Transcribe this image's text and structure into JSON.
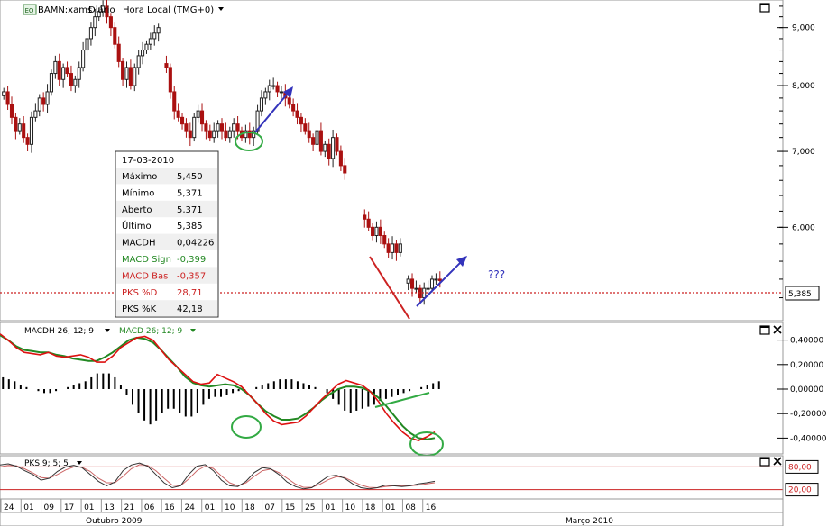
{
  "chart_data": [
    {
      "type": "candlestick",
      "header": {
        "instrument": "BAMN:xams",
        "badge": "EQ",
        "interval": "Diário",
        "timezone": "Hora Local (TMG+0)"
      },
      "ylim": [
        5.0,
        9.45
      ],
      "y_scale": "log",
      "yticks": [
        {
          "v": 9.0,
          "label": "9,000"
        },
        {
          "v": 8.0,
          "label": "8,000"
        },
        {
          "v": 7.0,
          "label": "7,000"
        },
        {
          "v": 6.0,
          "label": "6,000"
        }
      ],
      "last_price": {
        "v": 5.385,
        "label": "5,385",
        "color": "#cc2222"
      },
      "annotation_text": "???",
      "closes": [
        7.9,
        7.7,
        7.5,
        7.3,
        7.4,
        7.2,
        7.1,
        7.5,
        7.6,
        7.8,
        7.7,
        7.9,
        8.2,
        8.4,
        8.1,
        8.3,
        8.2,
        8.0,
        8.1,
        8.3,
        8.6,
        8.8,
        9.0,
        9.2,
        9.3,
        9.4,
        9.2,
        9.0,
        8.7,
        8.4,
        8.1,
        8.3,
        8.0,
        8.3,
        8.5,
        8.6,
        8.7,
        8.8,
        8.9,
        9.0,
        null,
        8.3,
        7.9,
        7.6,
        7.5,
        7.4,
        7.3,
        7.2,
        7.5,
        7.6,
        7.4,
        7.3,
        7.2,
        7.3,
        7.4,
        7.3,
        7.2,
        7.3,
        7.4,
        7.3,
        7.2,
        7.3,
        7.2,
        7.3,
        7.6,
        7.8,
        7.9,
        8.0,
        8.0,
        7.9,
        7.9,
        7.8,
        7.7,
        7.6,
        7.5,
        7.4,
        7.3,
        7.2,
        7.1,
        7.3,
        7.0,
        7.1,
        6.9,
        7.2,
        7.0,
        6.8,
        6.7,
        null,
        null,
        null,
        null,
        6.1,
        6.0,
        5.9,
        6.0,
        5.9,
        5.8,
        5.7,
        5.8,
        5.7,
        5.8,
        null,
        5.4,
        5.3,
        5.3,
        5.2,
        5.3,
        5.3,
        5.4,
        5.4,
        5.385
      ]
    },
    {
      "type": "line",
      "title": "MACDH 26; 12; 9",
      "series_title": "MACD 26; 12; 9",
      "ylim": [
        -0.5,
        0.5
      ],
      "yticks": [
        {
          "v": 0.4,
          "label": "0,40000"
        },
        {
          "v": 0.2,
          "label": "0,20000"
        },
        {
          "v": 0.0,
          "label": "0,00000"
        },
        {
          "v": -0.2,
          "label": "-0,20000"
        },
        {
          "v": -0.4,
          "label": "-0,40000"
        }
      ],
      "macd": [
        0.45,
        0.4,
        0.34,
        0.3,
        0.29,
        0.28,
        0.3,
        0.27,
        0.26,
        0.27,
        0.28,
        0.26,
        0.22,
        0.22,
        0.27,
        0.34,
        0.38,
        0.42,
        0.43,
        0.4,
        0.32,
        0.24,
        0.18,
        0.12,
        0.06,
        0.04,
        0.05,
        0.12,
        0.09,
        0.06,
        0.02,
        -0.05,
        -0.12,
        -0.2,
        -0.26,
        -0.29,
        -0.28,
        -0.27,
        -0.22,
        -0.15,
        -0.08,
        -0.02,
        0.04,
        0.07,
        0.05,
        0.03,
        -0.02,
        -0.1,
        -0.2,
        -0.28,
        -0.35,
        -0.4,
        -0.42,
        -0.39,
        -0.35
      ],
      "signal": [
        0.44,
        0.4,
        0.35,
        0.32,
        0.31,
        0.3,
        0.3,
        0.28,
        0.27,
        0.25,
        0.24,
        0.23,
        0.23,
        0.26,
        0.3,
        0.35,
        0.4,
        0.42,
        0.41,
        0.38,
        0.32,
        0.25,
        0.18,
        0.1,
        0.05,
        0.03,
        0.02,
        0.03,
        0.04,
        0.03,
        0.0,
        -0.05,
        -0.12,
        -0.18,
        -0.22,
        -0.25,
        -0.25,
        -0.24,
        -0.2,
        -0.15,
        -0.09,
        -0.04,
        0.0,
        0.02,
        0.02,
        0.01,
        -0.02,
        -0.07,
        -0.14,
        -0.22,
        -0.3,
        -0.36,
        -0.4,
        -0.41,
        -0.399
      ],
      "hist": [
        0.06,
        0.05,
        0.04,
        0.02,
        0.01,
        0.0,
        -0.01,
        -0.02,
        -0.02,
        -0.01,
        0.0,
        0.01,
        0.02,
        0.03,
        0.04,
        0.06,
        0.08,
        0.08,
        0.08,
        0.06,
        0.02,
        -0.03,
        -0.08,
        -0.12,
        -0.16,
        -0.18,
        -0.16,
        -0.12,
        -0.1,
        -0.1,
        -0.12,
        -0.14,
        -0.14,
        -0.12,
        -0.08,
        -0.05,
        -0.04,
        -0.04,
        -0.03,
        -0.02,
        -0.01,
        -0.01,
        0.0,
        0.01,
        0.02,
        0.03,
        0.04,
        0.05,
        0.05,
        0.05,
        0.04,
        0.03,
        0.02,
        0.01,
        0.0,
        -0.02,
        -0.05,
        -0.08,
        -0.11,
        -0.12,
        -0.11,
        -0.1,
        -0.09,
        -0.08,
        -0.06,
        -0.05,
        -0.04,
        -0.03,
        -0.02,
        -0.01,
        0.0,
        0.01,
        0.02,
        0.03,
        0.04
      ]
    },
    {
      "type": "line",
      "title": "PKS 9; 5; 5",
      "ylim": [
        0,
        100
      ],
      "levels": [
        {
          "v": 80,
          "label": "80,00",
          "color": "#cc2222"
        },
        {
          "v": 20,
          "label": "20,00",
          "color": "#cc2222"
        }
      ],
      "pks_k": [
        85,
        88,
        82,
        70,
        60,
        45,
        50,
        68,
        80,
        84,
        78,
        60,
        42,
        30,
        40,
        70,
        85,
        90,
        82,
        60,
        38,
        25,
        30,
        60,
        82,
        86,
        70,
        45,
        30,
        28,
        42,
        65,
        78,
        75,
        60,
        40,
        28,
        22,
        25,
        40,
        55,
        58,
        50,
        35,
        25,
        22,
        25,
        32,
        30,
        28,
        30,
        35,
        38,
        42
      ],
      "pks_d": [
        80,
        84,
        83,
        75,
        64,
        52,
        50,
        60,
        72,
        80,
        79,
        68,
        50,
        38,
        38,
        55,
        75,
        86,
        84,
        70,
        50,
        32,
        30,
        48,
        70,
        82,
        76,
        56,
        38,
        30,
        38,
        55,
        70,
        74,
        65,
        50,
        35,
        26,
        26,
        34,
        46,
        54,
        52,
        42,
        32,
        26,
        25,
        28,
        30,
        30,
        30,
        32,
        35,
        38
      ]
    }
  ],
  "tooltip": {
    "date": "17-03-2010",
    "rows": [
      {
        "label": "Máximo",
        "value": "5,450",
        "color": "#000000"
      },
      {
        "label": "Mínimo",
        "value": "5,371",
        "color": "#000000"
      },
      {
        "label": "Aberto",
        "value": "5,371",
        "color": "#000000"
      },
      {
        "label": "Último",
        "value": "5,385",
        "color": "#000000"
      },
      {
        "label": "MACDH",
        "value": "0,04226",
        "color": "#000000"
      },
      {
        "label": "MACD Sign",
        "value": "-0,399",
        "color": "#228822"
      },
      {
        "label": "MACD Bas",
        "value": "-0,357",
        "color": "#cc2222"
      },
      {
        "label": "PKS %D",
        "value": "28,71",
        "color": "#cc2222"
      },
      {
        "label": "PKS %K",
        "value": "42,18",
        "color": "#000000"
      }
    ]
  },
  "x_axis": {
    "ticks": [
      "24",
      "01",
      "09",
      "17",
      "01",
      "13",
      "21",
      "06",
      "16",
      "24",
      "01",
      "10",
      "18",
      "07",
      "15",
      "25",
      "01",
      "10",
      "18",
      "01",
      "08",
      "16"
    ],
    "months": [
      "Outubro 2009",
      "Março 2010"
    ]
  },
  "colors": {
    "up": "#222222",
    "down": "#aa1111",
    "macd": "#dd1111",
    "signal": "#228822",
    "annot_blue": "#3333bb",
    "annot_green": "#33aa44"
  }
}
